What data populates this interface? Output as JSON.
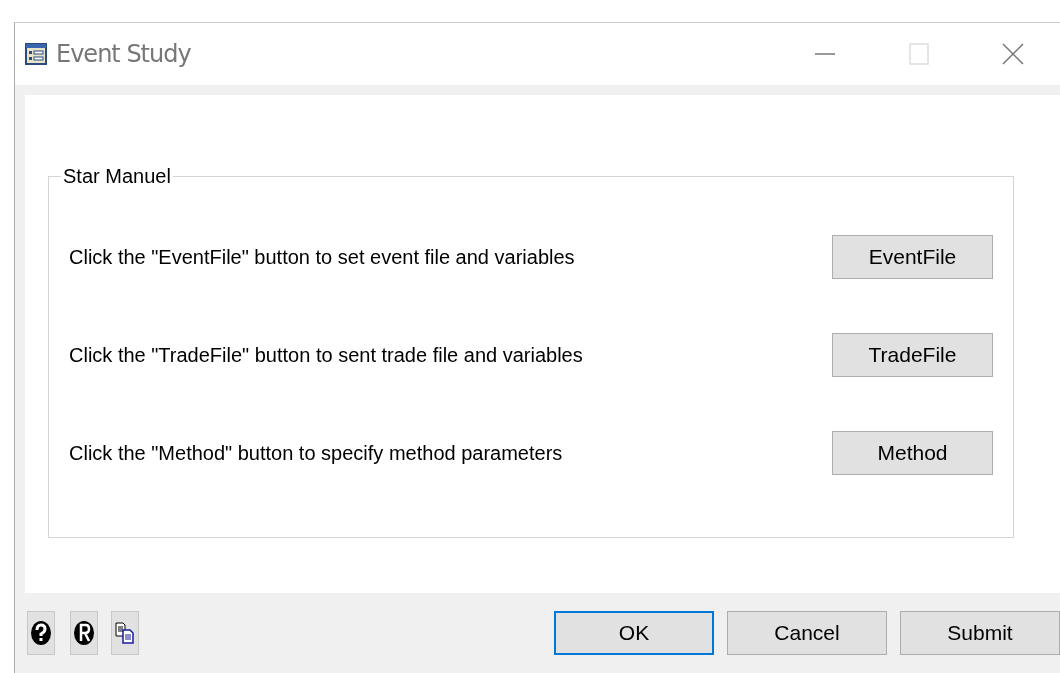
{
  "window": {
    "title": "Event Study",
    "controls": [
      {
        "kind": "minimize",
        "disabled": false
      },
      {
        "kind": "maximize",
        "disabled": true
      },
      {
        "kind": "close",
        "disabled": false
      }
    ]
  },
  "group": {
    "legend": "Star Manuel",
    "rows": [
      {
        "text": "Click the \"EventFile\" button to set event file and variables",
        "button": "EventFile"
      },
      {
        "text": "Click the \"TradeFile\" button to sent trade file and variables",
        "button": "TradeFile"
      },
      {
        "text": "Click the \"Method\" button to specify method parameters",
        "button": "Method"
      }
    ]
  },
  "tool_buttons": [
    {
      "kind": "help"
    },
    {
      "kind": "info"
    },
    {
      "kind": "copy"
    }
  ],
  "buttons": [
    {
      "label": "OK",
      "default": true
    },
    {
      "label": "Cancel",
      "default": false
    },
    {
      "label": "Submit",
      "default": false
    }
  ]
}
